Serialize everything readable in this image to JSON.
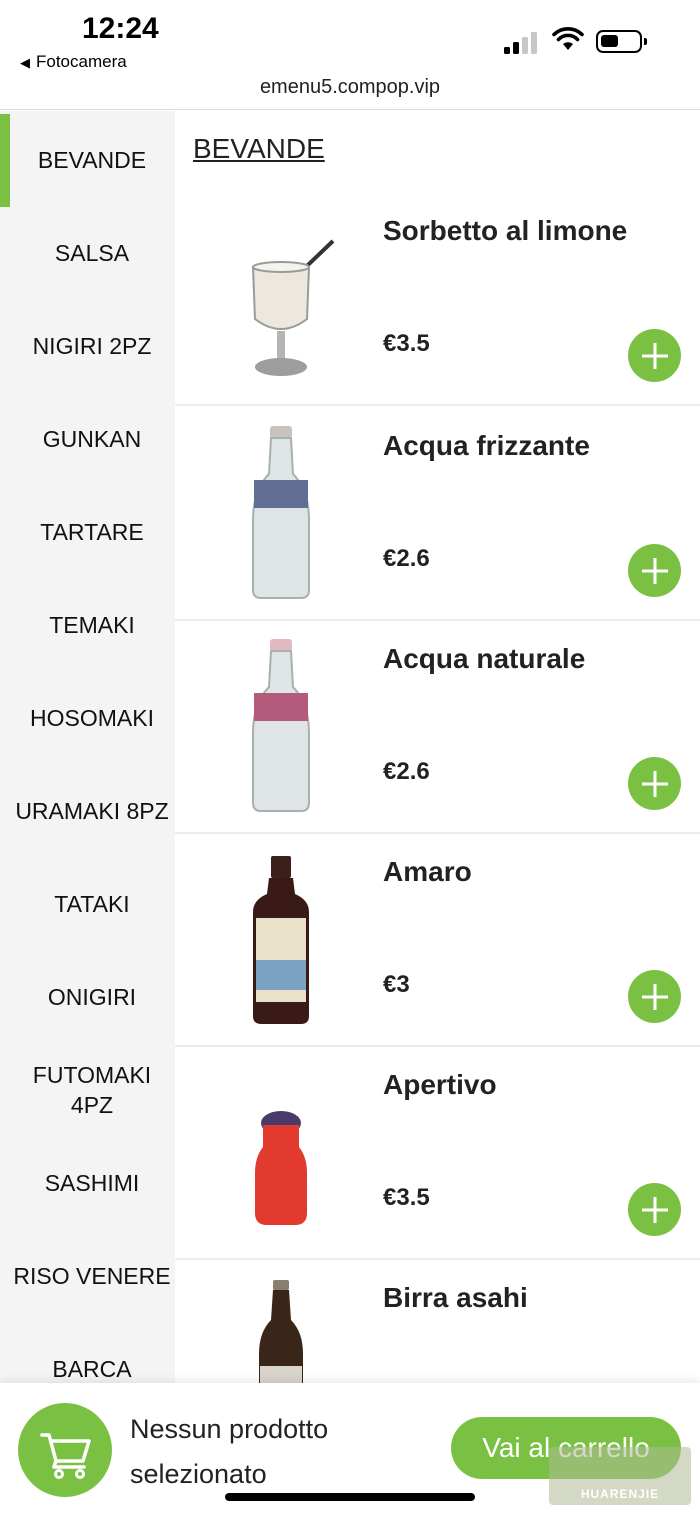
{
  "status_bar": {
    "time": "12:24",
    "back_label": "Fotocamera",
    "url": "emenu5.compop.vip",
    "signal_bars_active": 2,
    "signal_bars_total": 4,
    "battery_level": 0.45
  },
  "sidebar": {
    "active_index": 0,
    "accent_color": "#7ac143",
    "items": [
      {
        "label": "BEVANDE"
      },
      {
        "label": "SALSA"
      },
      {
        "label": "NIGIRI 2PZ"
      },
      {
        "label": "GUNKAN"
      },
      {
        "label": "TARTARE"
      },
      {
        "label": "TEMAKI"
      },
      {
        "label": "HOSOMAKI"
      },
      {
        "label": "URAMAKI 8PZ"
      },
      {
        "label": "TATAKI"
      },
      {
        "label": "ONIGIRI"
      },
      {
        "label": "FUTOMAKI 4PZ"
      },
      {
        "label": "SASHIMI"
      },
      {
        "label": "RISO VENERE"
      },
      {
        "label": "BARCA"
      }
    ]
  },
  "main": {
    "section_title": "BEVANDE",
    "products": [
      {
        "name": "Sorbetto al limone",
        "price": "€3.5",
        "image_icon": "sorbet-glass-icon"
      },
      {
        "name": "Acqua frizzante",
        "price": "€2.6",
        "image_icon": "water-bottle-icon"
      },
      {
        "name": "Acqua naturale",
        "price": "€2.6",
        "image_icon": "water-bottle-icon"
      },
      {
        "name": "Amaro",
        "price": "€3",
        "image_icon": "liqueur-bottle-icon"
      },
      {
        "name": "Apertivo",
        "price": "€3.5",
        "image_icon": "aperitif-bottle-icon"
      },
      {
        "name": "Birra asahi",
        "price": "",
        "image_icon": "beer-bottle-icon"
      }
    ]
  },
  "cart": {
    "status_text": "Nessun prodotto selezionato",
    "button_label": "Vai al carrello",
    "icon": "shopping-cart-icon"
  },
  "watermark": {
    "text": "HUARENJIE"
  },
  "colors": {
    "accent": "#7ac143",
    "sidebar_bg": "#f4f4f4"
  }
}
